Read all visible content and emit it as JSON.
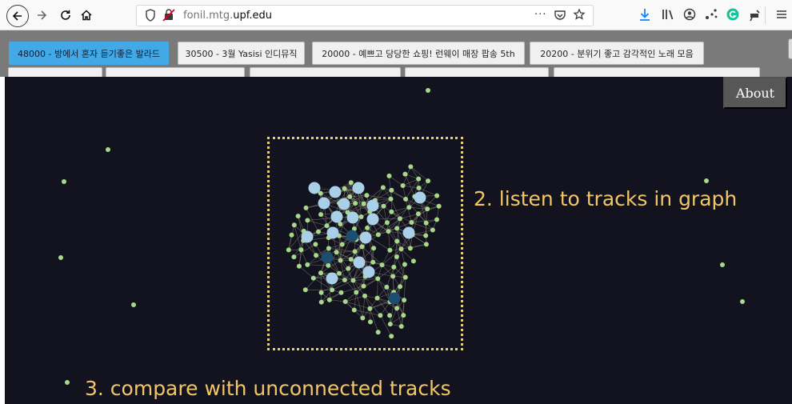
{
  "browser": {
    "url_prefix": "fonil.mtg.",
    "url_domain": "upf.edu",
    "more_icon": "···"
  },
  "playlists": [
    {
      "label": "48000 - 방에서 혼자 듣기좋은 발라드",
      "active": true
    },
    {
      "label": "30500 - 3월 Yasisi 인디뮤직",
      "active": false
    },
    {
      "label": "20000 - 예쁘고 당당한 쇼핑! 런웨이 매장 팝송 5th",
      "active": false
    },
    {
      "label": "20200 - 분위기 좋고 감각적인 노래 모음",
      "active": false
    },
    {
      "label": "",
      "active": false
    },
    {
      "label": "",
      "active": false
    },
    {
      "label": "",
      "active": false
    },
    {
      "label": "",
      "active": false
    },
    {
      "label": "",
      "active": false
    }
  ],
  "about_label": "About",
  "instructions": {
    "step2": "2. listen to tracks in graph",
    "step3": "3. compare with unconnected tracks"
  },
  "colors": {
    "background": "#13121f",
    "track_node": "#a6d98a",
    "playing_node": "#aacfe8",
    "seed_node": "#1d4e6e",
    "edge": "#8c8474",
    "label": "#f2c766",
    "box_border": "#f4cf56",
    "active_playlist": "#42a8e6"
  }
}
